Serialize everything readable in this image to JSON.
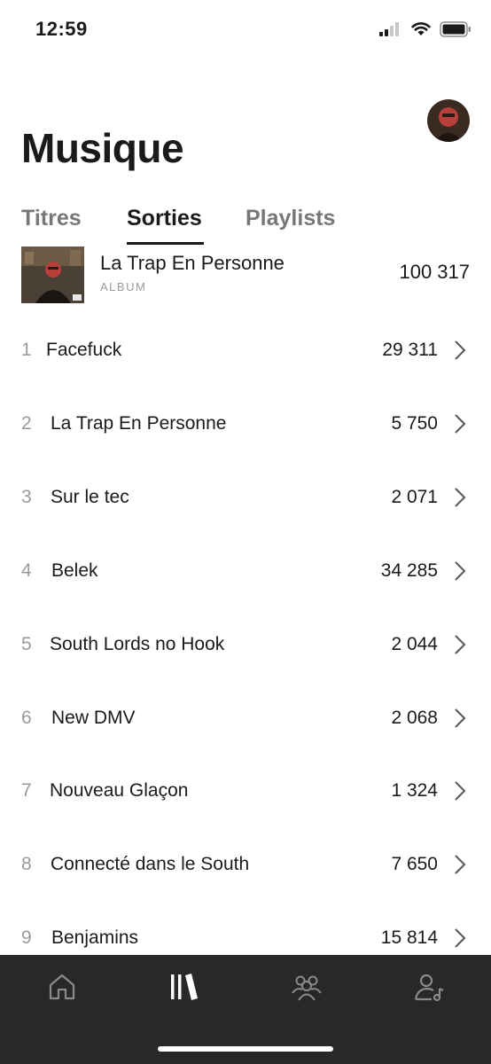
{
  "status_bar": {
    "time": "12:59"
  },
  "header": {
    "title": "Musique"
  },
  "tabs": [
    {
      "label": "Titres",
      "active": false
    },
    {
      "label": "Sorties",
      "active": true
    },
    {
      "label": "Playlists",
      "active": false
    }
  ],
  "album": {
    "title": "La Trap En Personne",
    "type": "ALBUM",
    "count": "100 317"
  },
  "tracks": [
    {
      "num": "1",
      "title": "Facefuck",
      "count": "29 311"
    },
    {
      "num": "2",
      "title": "La Trap En Personne",
      "count": "5 750"
    },
    {
      "num": "3",
      "title": "Sur le tec",
      "count": "2 071"
    },
    {
      "num": "4",
      "title": "Belek",
      "count": "34 285"
    },
    {
      "num": "5",
      "title": "South Lords no Hook",
      "count": "2 044"
    },
    {
      "num": "6",
      "title": "New DMV",
      "count": "2 068"
    },
    {
      "num": "7",
      "title": "Nouveau Glaçon",
      "count": "1 324"
    },
    {
      "num": "8",
      "title": "Connecté dans le South",
      "count": "7 650"
    },
    {
      "num": "9",
      "title": "Benjamins",
      "count": "15 814"
    }
  ],
  "bottom_nav": {
    "icons": [
      "home-icon",
      "library-icon",
      "audience-icon",
      "artist-profile-icon"
    ],
    "active": "library-icon"
  },
  "colors": {
    "text": "#1a1a1a",
    "muted": "#9a9a9a",
    "tab_inactive": "#777777",
    "nav_background": "#282828",
    "nav_icon": "#8a8a8a",
    "nav_icon_active": "#ffffff"
  }
}
